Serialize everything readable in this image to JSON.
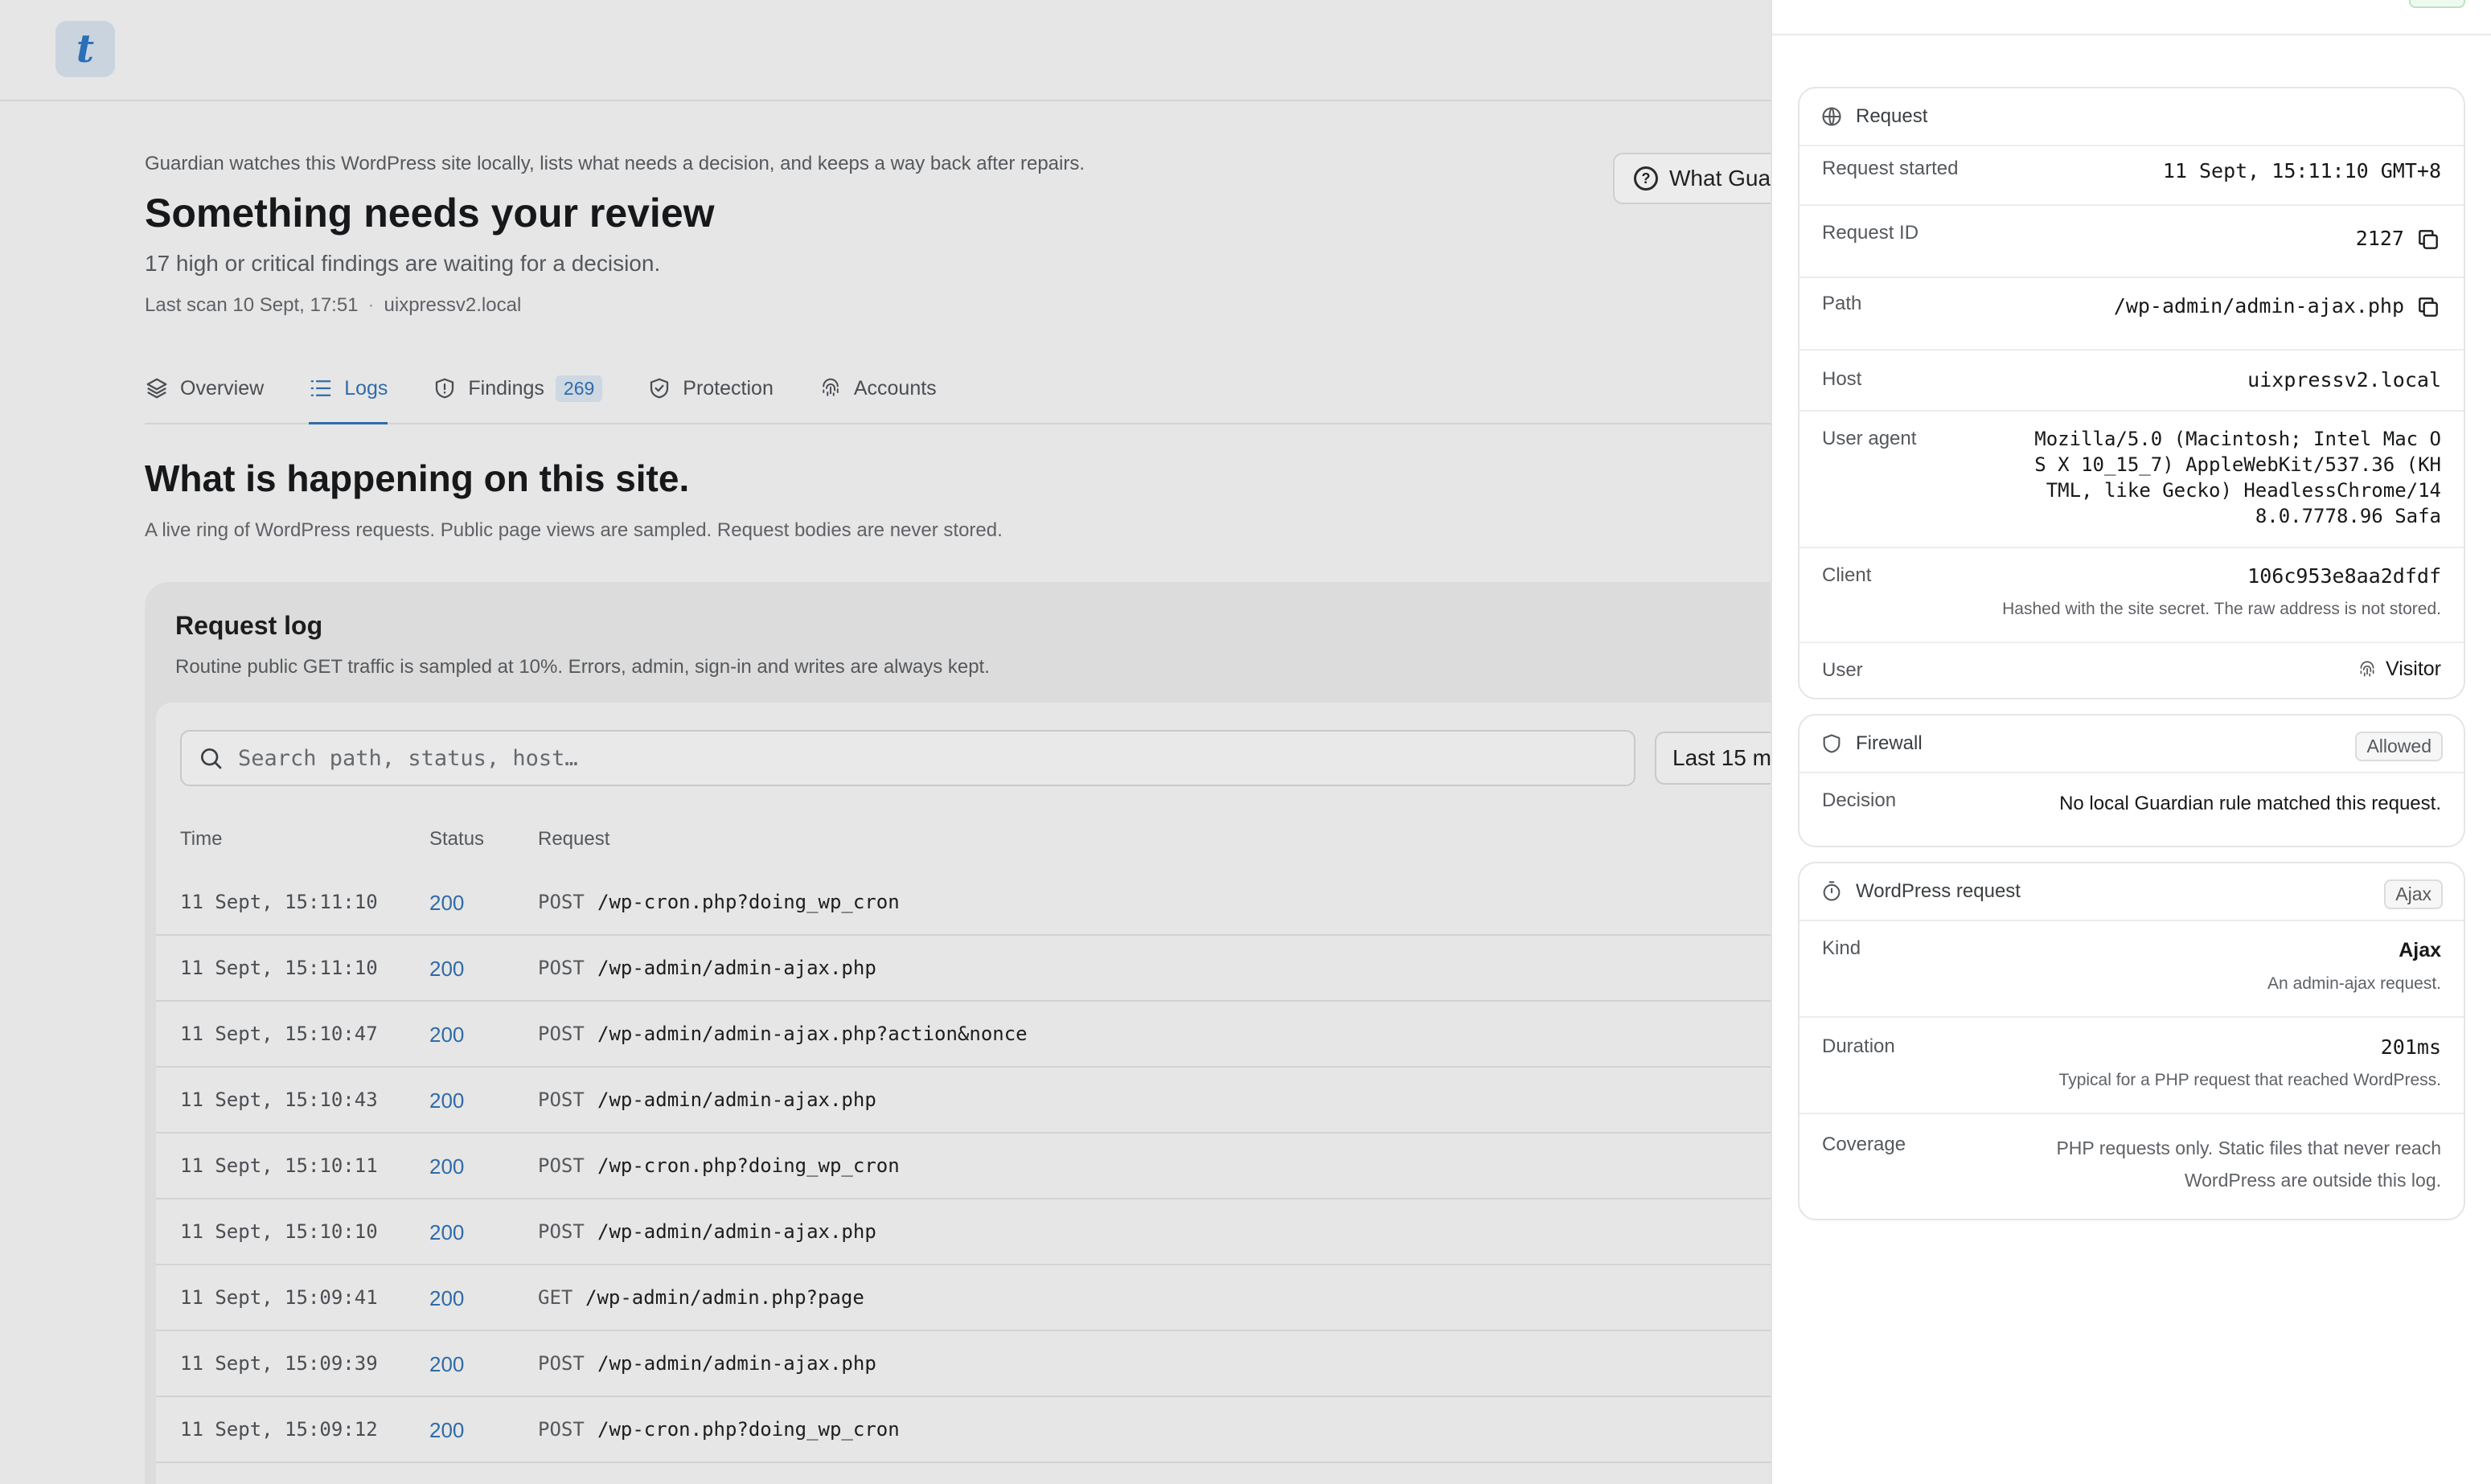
{
  "app": {
    "logo_letter": "t",
    "eyebrow": "Guardian watches this WordPress site locally, lists what needs a decision, and keeps a way back after repairs.",
    "title": "Something needs your review",
    "subtitle": "17 high or critical findings are waiting for a decision.",
    "last_scan": "Last scan 10 Sept, 17:51",
    "meta_separator": "·",
    "host": "uixpressv2.local",
    "what_button_label": "What Gua"
  },
  "tabs": [
    {
      "label": "Overview",
      "icon": "layers-icon",
      "active": false
    },
    {
      "label": "Logs",
      "icon": "list-icon",
      "active": true
    },
    {
      "label": "Findings",
      "icon": "shield-alert-icon",
      "active": false,
      "count": "269"
    },
    {
      "label": "Protection",
      "icon": "shield-check-icon",
      "active": false
    },
    {
      "label": "Accounts",
      "icon": "fingerprint-icon",
      "active": false
    }
  ],
  "section": {
    "title": "What is happening on this site.",
    "description": "A live ring of WordPress requests. Public page views are sampled. Request bodies are never stored."
  },
  "log": {
    "title": "Request log",
    "description": "Routine public GET traffic is sampled at 10%. Errors, admin, sign-in and writes are always kept.",
    "search_placeholder": "Search path, status, host…",
    "range_label": "Last 15 m",
    "columns": {
      "time": "Time",
      "status": "Status",
      "request": "Request"
    },
    "rows": [
      {
        "time": "11 Sept, 15:11:10",
        "status": "200",
        "method": "POST",
        "path": "/wp-cron.php?doing_wp_cron"
      },
      {
        "time": "11 Sept, 15:11:10",
        "status": "200",
        "method": "POST",
        "path": "/wp-admin/admin-ajax.php"
      },
      {
        "time": "11 Sept, 15:10:47",
        "status": "200",
        "method": "POST",
        "path": "/wp-admin/admin-ajax.php?action&nonce"
      },
      {
        "time": "11 Sept, 15:10:43",
        "status": "200",
        "method": "POST",
        "path": "/wp-admin/admin-ajax.php"
      },
      {
        "time": "11 Sept, 15:10:11",
        "status": "200",
        "method": "POST",
        "path": "/wp-cron.php?doing_wp_cron"
      },
      {
        "time": "11 Sept, 15:10:10",
        "status": "200",
        "method": "POST",
        "path": "/wp-admin/admin-ajax.php"
      },
      {
        "time": "11 Sept, 15:09:41",
        "status": "200",
        "method": "GET",
        "path": "/wp-admin/admin.php?page"
      },
      {
        "time": "11 Sept, 15:09:39",
        "status": "200",
        "method": "POST",
        "path": "/wp-admin/admin-ajax.php"
      },
      {
        "time": "11 Sept, 15:09:12",
        "status": "200",
        "method": "POST",
        "path": "/wp-cron.php?doing_wp_cron"
      }
    ]
  },
  "drawer": {
    "request": {
      "heading": "Request",
      "started_label": "Request started",
      "started_value": "11 Sept, 15:11:10 GMT+8",
      "id_label": "Request ID",
      "id_value": "2127",
      "path_label": "Path",
      "path_value": "/wp-admin/admin-ajax.php",
      "host_label": "Host",
      "host_value": "uixpressv2.local",
      "ua_label": "User agent",
      "ua_lines": [
        "Mozilla/5.0 (Macintosh; Intel Mac O",
        "S X 10_15_7) AppleWebKit/537.36 (KH",
        "TML, like Gecko) HeadlessChrome/14",
        "8.0.7778.96 Safa"
      ],
      "client_label": "Client",
      "client_value": "106c953e8aa2dfdf",
      "client_note": "Hashed with the site secret. The raw address is not stored.",
      "user_label": "User",
      "user_value": "Visitor"
    },
    "firewall": {
      "heading": "Firewall",
      "tag": "Allowed",
      "decision_label": "Decision",
      "decision_value": "No local Guardian rule matched this request."
    },
    "wp_request": {
      "heading": "WordPress request",
      "tag": "Ajax",
      "kind_label": "Kind",
      "kind_value": "Ajax",
      "kind_note": "An admin-ajax request.",
      "duration_label": "Duration",
      "duration_value": "201ms",
      "duration_note": "Typical for a PHP request that reached WordPress.",
      "coverage_label": "Coverage",
      "coverage_lines": [
        "PHP requests only. Static files that never reach",
        "WordPress are outside this log."
      ]
    }
  },
  "colors": {
    "accent": "#2f6ba8",
    "page_bg": "#e6e6e6",
    "drawer_bg": "#ffffff"
  }
}
